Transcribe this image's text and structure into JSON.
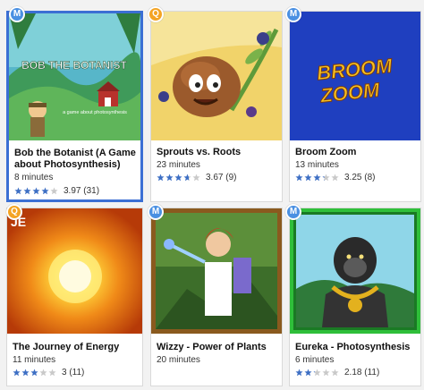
{
  "cards": [
    {
      "badge": "M",
      "title": "Bob the Botanist (A Game about Photosynthesis)",
      "minutes": "8 minutes",
      "rating": 3.97,
      "rating_text": "3.97 (31)",
      "thumb_title": "BOB THE BOTANIST",
      "thumb_sub": "a game about photosynthesis",
      "selected": true
    },
    {
      "badge": "Q",
      "title": "Sprouts vs. Roots",
      "minutes": "23 minutes",
      "rating": 3.67,
      "rating_text": "3.67 (9)"
    },
    {
      "badge": "M",
      "title": "Broom Zoom",
      "minutes": "13 minutes",
      "rating": 3.25,
      "rating_text": "3.25 (8)",
      "thumb_line1": "BROOM",
      "thumb_line2": "ZOOM"
    },
    {
      "badge": "Q",
      "title": "The Journey of Energy",
      "minutes": "11 minutes",
      "rating": 3,
      "rating_text": "3 (11)",
      "thumb_corner": "JE"
    },
    {
      "badge": "M",
      "title": "Wizzy - Power of Plants",
      "minutes": "20 minutes",
      "rating": null,
      "rating_text": ""
    },
    {
      "badge": "M",
      "title": "Eureka - Photosynthesis",
      "minutes": "6 minutes",
      "rating": 2.18,
      "rating_text": "2.18 (11)"
    }
  ],
  "colors": {
    "star_filled": "#3d6fc4",
    "star_empty": "#c9c9c9",
    "badge_m": "#4a90e2",
    "badge_q": "#f4a424",
    "selected_border": "#3b6fd4"
  }
}
